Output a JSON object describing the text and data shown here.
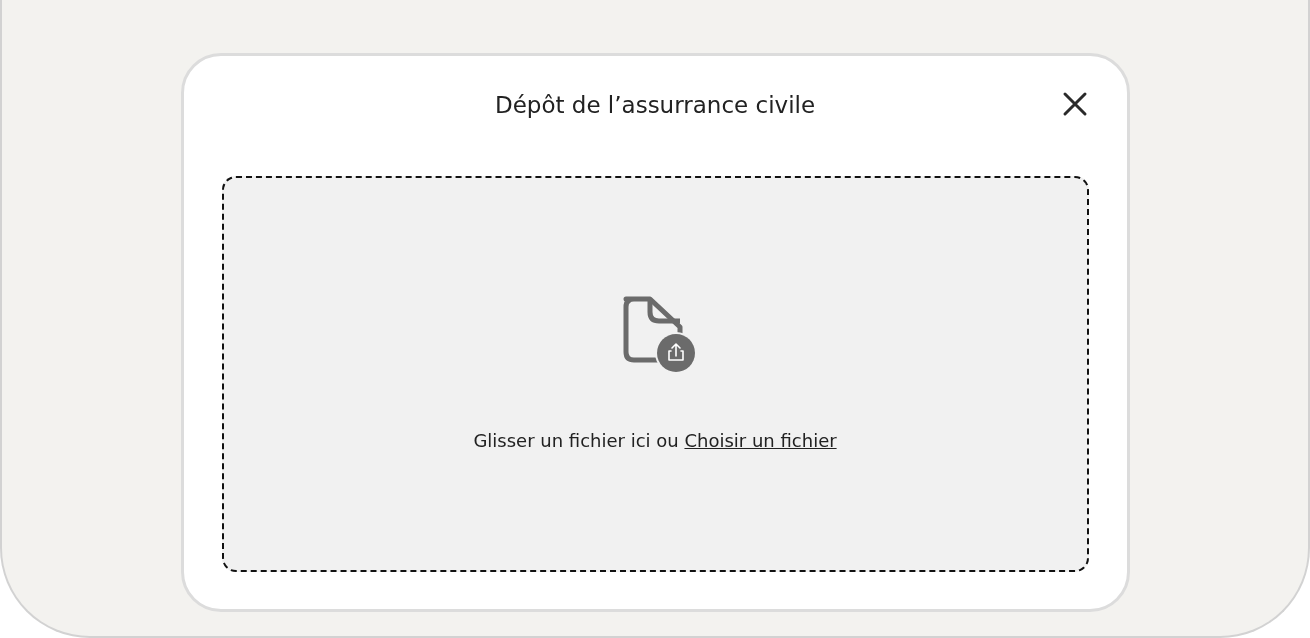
{
  "dialog": {
    "title": "Dépôt de l’assurrance civile"
  },
  "dropzone": {
    "prompt": "Glisser un fichier ici ou",
    "link": "Choisir un fichier"
  }
}
